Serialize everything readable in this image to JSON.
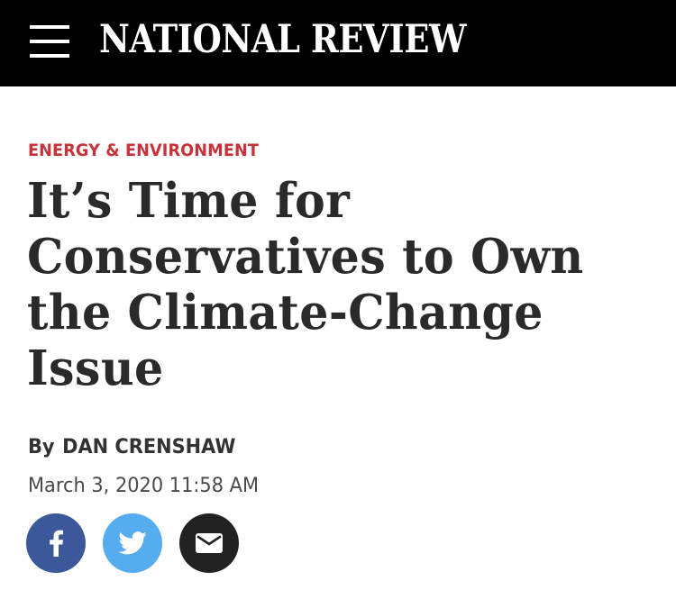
{
  "header": {
    "brand": "NATIONAL REVIEW",
    "menu_icon": "hamburger-menu-icon",
    "background": "#000000"
  },
  "article": {
    "category": "ENERGY & ENVIRONMENT",
    "category_color": "#c8323a",
    "headline": "It’s Time for Conservatives to Own the Climate-Change Issue",
    "byline_prefix": "By",
    "author": "DAN CRENSHAW",
    "date": "March 3, 2020 11:58 AM"
  },
  "share": [
    {
      "network": "facebook",
      "icon": "facebook-icon",
      "color": "#3b5998"
    },
    {
      "network": "twitter",
      "icon": "twitter-icon",
      "color": "#55acee"
    },
    {
      "network": "email",
      "icon": "envelope-icon",
      "color": "#222222"
    }
  ]
}
